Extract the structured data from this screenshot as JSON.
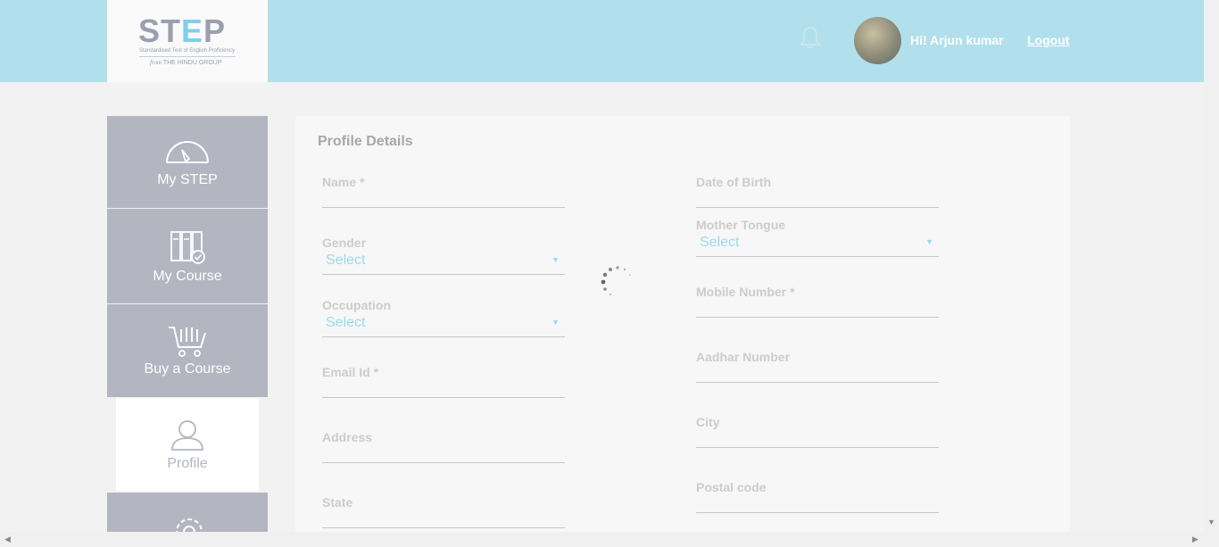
{
  "header": {
    "logo_text_left": "ST",
    "logo_text_e": "E",
    "logo_text_right": "P",
    "logo_subtitle": "Standardised Test of English Proficiency",
    "logo_from_word": "from",
    "logo_from_org": "THE HINDU GROUP",
    "greeting": "Hi! Arjun kumar",
    "logout_label": "Logout",
    "bell_icon": "bell-icon",
    "colors": {
      "header_bg": "#b1e0ec",
      "sidebar_bg": "#b3b5c1",
      "select_text": "#9bdaeb"
    }
  },
  "sidebar": {
    "items": [
      {
        "label": "My STEP",
        "icon": "speedometer-icon"
      },
      {
        "label": "My Course",
        "icon": "books-check-icon"
      },
      {
        "label": "Buy a Course",
        "icon": "cart-icon"
      },
      {
        "label": "Profile",
        "icon": "user-icon"
      },
      {
        "label": "",
        "icon": "gear-icon"
      }
    ]
  },
  "profile": {
    "title": "Profile Details",
    "name_label": "Name *",
    "dob_label": "Date of Birth",
    "mother_tongue_label": "Mother Tongue",
    "mother_tongue_value": "Select",
    "gender_label": "Gender",
    "gender_value": "Select",
    "mobile_label": "Mobile Number *",
    "occupation_label": "Occupation",
    "occupation_value": "Select",
    "aadhar_label": "Aadhar Number",
    "email_label": "Email Id *",
    "city_label": "City",
    "address_label": "Address",
    "postal_label": "Postal code",
    "state_label": "State"
  }
}
